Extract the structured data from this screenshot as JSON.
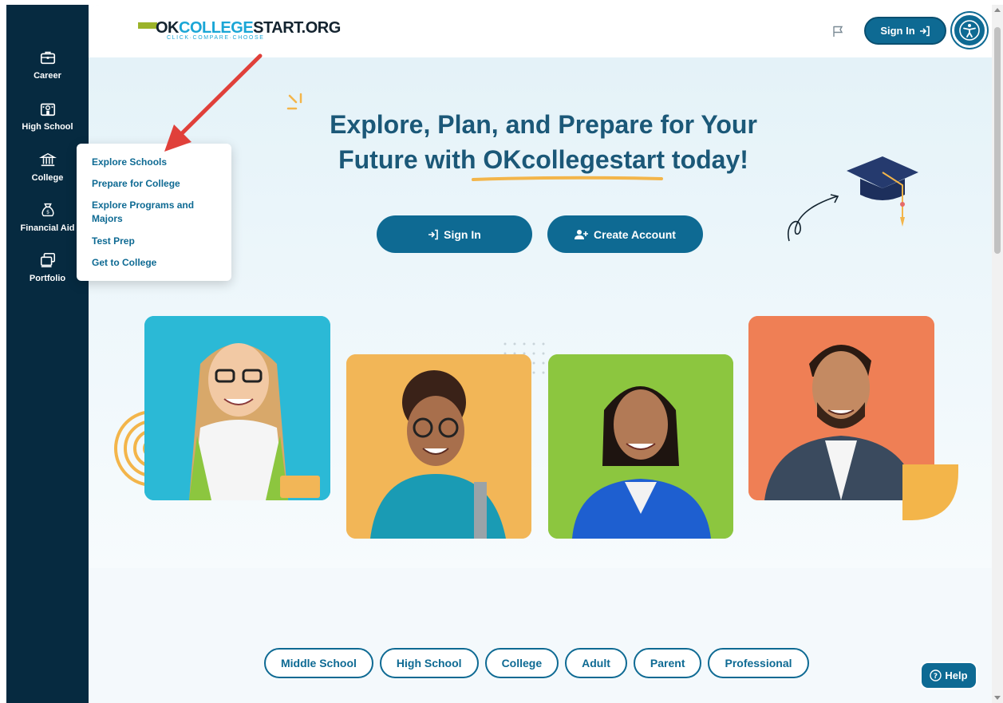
{
  "colors": {
    "sidebar_bg": "#062a40",
    "primary": "#0e6a93",
    "headline": "#1b5878",
    "accent_yellow": "#f3b54a",
    "photo_blue": "#2bb9d6",
    "photo_orange": "#f2b657",
    "photo_green": "#8cc63f",
    "photo_coral": "#ef7f55"
  },
  "header": {
    "logo_ok": "OK",
    "logo_college": "COLLEGE",
    "logo_start": "START.ORG",
    "logo_tagline": "CLICK·COMPARE·CHOOSE",
    "flag_icon": "flag-icon",
    "signin_label": "Sign In",
    "accessibility_icon": "accessibility-icon"
  },
  "sidebar": {
    "items": [
      {
        "label": "Career",
        "icon": "briefcase-icon"
      },
      {
        "label": "High School",
        "icon": "school-building-icon"
      },
      {
        "label": "College",
        "icon": "bank-building-icon"
      },
      {
        "label": "Financial Aid",
        "icon": "money-bag-icon"
      },
      {
        "label": "Portfolio",
        "icon": "portfolio-icon"
      }
    ]
  },
  "college_menu": {
    "items": [
      "Explore Schools",
      "Prepare for College",
      "Explore Programs and Majors",
      "Test Prep",
      "Get to College"
    ]
  },
  "hero": {
    "headline_line1": "Explore, Plan, and Prepare for Your",
    "headline_line2": "Future with OKcollegestart today!",
    "signin_button": "Sign In",
    "create_account_button": "Create Account"
  },
  "audience_tabs": [
    "Middle School",
    "High School",
    "College",
    "Adult",
    "Parent",
    "Professional"
  ],
  "help_button": "Help"
}
